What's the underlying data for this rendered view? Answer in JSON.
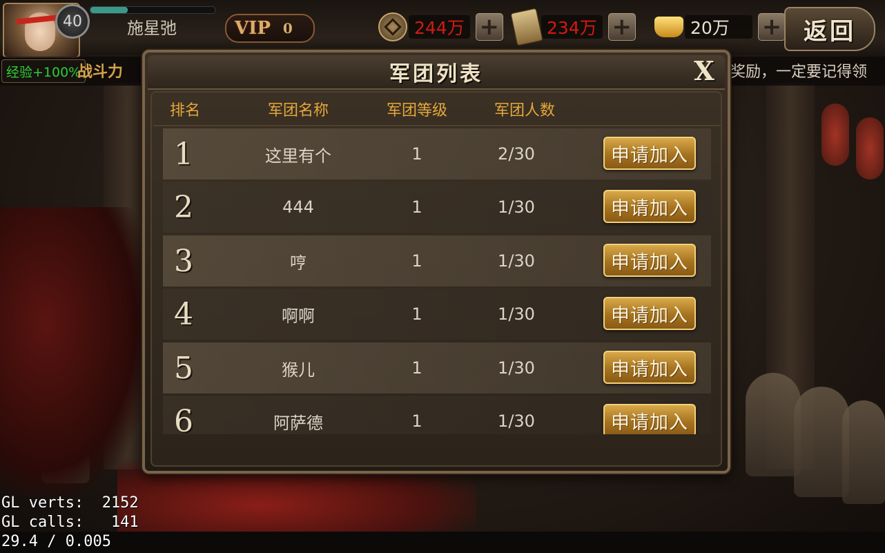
{
  "player": {
    "level": "40",
    "exp_progress": 0.3,
    "name": "施星弛",
    "vip_label": "VIP",
    "vip_level": "0"
  },
  "currencies": [
    {
      "icon": "coin-icon",
      "value": "244万",
      "color": "#d41a12"
    },
    {
      "icon": "token-icon",
      "value": "234万",
      "color": "#d41a12"
    },
    {
      "icon": "gold-ingot-icon",
      "value": "20万",
      "color": "#e8e0d2"
    }
  ],
  "plus_label": "+",
  "return_label": "返回",
  "exp_bonus": "经验+100%",
  "power_label": "战斗力",
  "marquee": "奖励，一定要记得领",
  "dialog": {
    "title": "军团列表",
    "close_label": "X",
    "columns": [
      "排名",
      "军团名称",
      "军团等级",
      "军团人数"
    ],
    "join_label": "申请加入",
    "rows": [
      {
        "rank": "1",
        "name": "这里有个",
        "level": "1",
        "members": "2/30"
      },
      {
        "rank": "2",
        "name": "444",
        "level": "1",
        "members": "1/30"
      },
      {
        "rank": "3",
        "name": "哼",
        "level": "1",
        "members": "1/30"
      },
      {
        "rank": "4",
        "name": "啊啊",
        "level": "1",
        "members": "1/30"
      },
      {
        "rank": "5",
        "name": "猴儿",
        "level": "1",
        "members": "1/30"
      },
      {
        "rank": "6",
        "name": "阿萨德",
        "level": "1",
        "members": "1/30"
      }
    ]
  },
  "debug": {
    "verts": "GL verts:  2152",
    "calls": "GL calls:   141",
    "fps": "29.4 / 0.005"
  },
  "colors": {
    "header_text": "#e6a83a",
    "button_gold": "#c8953a",
    "currency_red": "#d41a12",
    "exp_green": "#2ccf3a"
  }
}
